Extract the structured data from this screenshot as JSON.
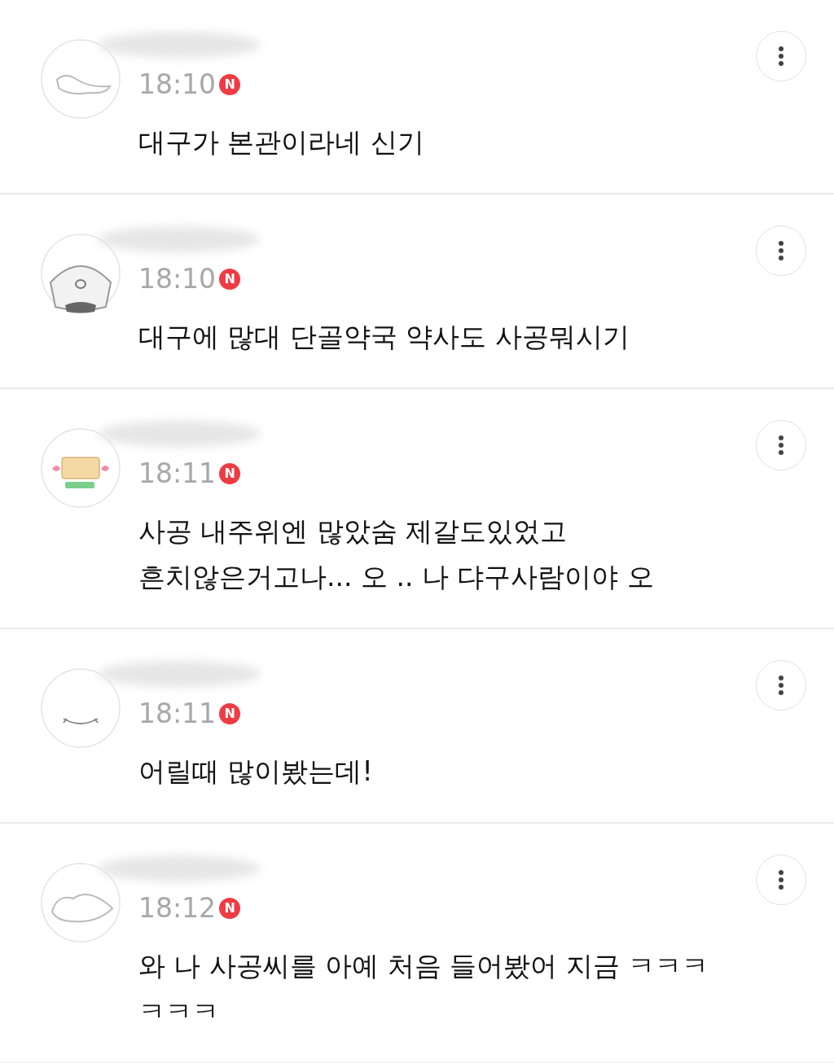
{
  "comments": [
    {
      "time": "18:10",
      "badge": "N",
      "lines": [
        "대구가 본관이라네 신기"
      ]
    },
    {
      "time": "18:10",
      "badge": "N",
      "lines": [
        "대구에 많대 단골약국 약사도 사공뭐시기"
      ]
    },
    {
      "time": "18:11",
      "badge": "N",
      "lines": [
        "사공 내주위엔 많았숨 제갈도있었고",
        "흔치않은거고나... 오 .. 나 댜구사람이야 오"
      ]
    },
    {
      "time": "18:11",
      "badge": "N",
      "lines": [
        "어릴때 많이봤는데!"
      ]
    },
    {
      "time": "18:12",
      "badge": "N",
      "lines": [
        "와 나 사공씨를 아예 처음 들어봤어 지금 ㅋㅋㅋ",
        "ㅋㅋㅋ"
      ]
    }
  ]
}
